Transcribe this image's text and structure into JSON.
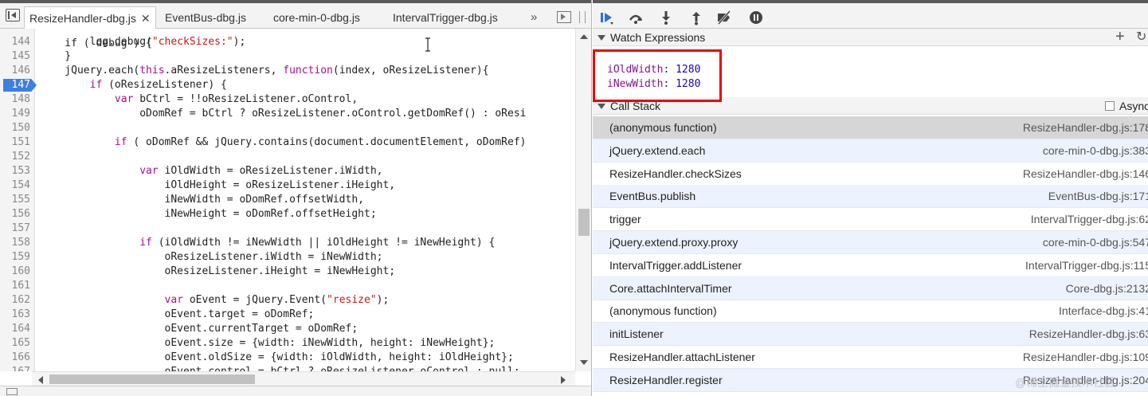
{
  "tabs": [
    {
      "label": "ResizeHandler-dbg.js",
      "active": true
    },
    {
      "label": "EventBus-dbg.js",
      "active": false
    },
    {
      "label": "core-min-0-dbg.js",
      "active": false
    },
    {
      "label": "IntervalTrigger-dbg.js",
      "active": false
    }
  ],
  "tab_overflow": "»",
  "code_lines": [
    {
      "n": "144",
      "html": "        log.debug(<span class='str'>\"checkSizes:\"</span>);"
    },
    {
      "n": "145",
      "html": "    }"
    },
    {
      "n": "146",
      "html": "    jQuery.each(<span class='kw'>this</span>.aResizeListeners, <span class='kw'>function</span>(index, oResizeListener){"
    },
    {
      "n": "147",
      "html": "        <span class='kw'>if</span> (oResizeListener) {",
      "breakpoint": true
    },
    {
      "n": "148",
      "html": "            <span class='kw'>var</span> bCtrl = !!oResizeListener.oControl,"
    },
    {
      "n": "149",
      "html": "                oDomRef = bCtrl ? oResizeListener.oControl.getDomRef() : oResi"
    },
    {
      "n": "150",
      "html": ""
    },
    {
      "n": "151",
      "html": "            <span class='kw'>if</span> ( oDomRef &amp;&amp; jQuery.contains(document.documentElement, oDomRef)"
    },
    {
      "n": "152",
      "html": ""
    },
    {
      "n": "153",
      "html": "                <span class='kw'>var</span> iOldWidth = oResizeListener.iWidth,"
    },
    {
      "n": "154",
      "html": "                    iOldHeight = oResizeListener.iHeight,"
    },
    {
      "n": "155",
      "html": "                    iNewWidth = oDomRef.offsetWidth,"
    },
    {
      "n": "156",
      "html": "                    iNewHeight = oDomRef.offsetHeight;"
    },
    {
      "n": "157",
      "html": ""
    },
    {
      "n": "158",
      "html": "                <span class='kw'>if</span> (iOldWidth != iNewWidth || iOldHeight != iNewHeight) {"
    },
    {
      "n": "159",
      "html": "                    oResizeListener.iWidth = iNewWidth;"
    },
    {
      "n": "160",
      "html": "                    oResizeListener.iHeight = iNewHeight;"
    },
    {
      "n": "161",
      "html": ""
    },
    {
      "n": "162",
      "html": "                    <span class='kw'>var</span> oEvent = jQuery.Event(<span class='str'>\"resize\"</span>);"
    },
    {
      "n": "163",
      "html": "                    oEvent.target = oDomRef;"
    },
    {
      "n": "164",
      "html": "                    oEvent.currentTarget = oDomRef;"
    },
    {
      "n": "165",
      "html": "                    oEvent.size = {width: iNewWidth, height: iNewHeight};"
    },
    {
      "n": "166",
      "html": "                    oEvent.oldSize = {width: iOldWidth, height: iOldHeight};"
    },
    {
      "n": "167",
      "html": "                    oEvent.control = bCtrl ? oResizeListener.oControl : null;"
    },
    {
      "n": "168",
      "html": ""
    }
  ],
  "top_partial_line": "    if ( debug ) {",
  "toolbar": {
    "resume": "resume-icon",
    "step_over": "step-over-icon",
    "step_into": "step-into-icon",
    "step_out": "step-out-icon",
    "deactivate": "deactivate-breakpoints-icon",
    "pause": "pause-on-exceptions-icon"
  },
  "watch": {
    "title": "Watch Expressions",
    "add": "+",
    "refresh": "↻",
    "items": [
      {
        "name": "iOldWidth",
        "sep": ": ",
        "value": "1280"
      },
      {
        "name": "iNewWidth",
        "sep": ": ",
        "value": "1280"
      }
    ]
  },
  "callstack": {
    "title": "Call Stack",
    "async_label": "Async",
    "frames": [
      {
        "fn": "(anonymous function)",
        "loc": "ResizeHandler-dbg.js:178",
        "selected": true
      },
      {
        "fn": "jQuery.extend.each",
        "loc": "core-min-0-dbg.js:383"
      },
      {
        "fn": "ResizeHandler.checkSizes",
        "loc": "ResizeHandler-dbg.js:146"
      },
      {
        "fn": "EventBus.publish",
        "loc": "EventBus-dbg.js:171"
      },
      {
        "fn": "trigger",
        "loc": "IntervalTrigger-dbg.js:62"
      },
      {
        "fn": "jQuery.extend.proxy.proxy",
        "loc": "core-min-0-dbg.js:547"
      },
      {
        "fn": "IntervalTrigger.addListener",
        "loc": "IntervalTrigger-dbg.js:115"
      },
      {
        "fn": "Core.attachIntervalTimer",
        "loc": "Core-dbg.js:2132"
      },
      {
        "fn": "(anonymous function)",
        "loc": "Interface-dbg.js:41"
      },
      {
        "fn": "initListener",
        "loc": "ResizeHandler-dbg.js:63"
      },
      {
        "fn": "ResizeHandler.attachListener",
        "loc": "ResizeHandler-dbg.js:109"
      },
      {
        "fn": "ResizeHandler.register",
        "loc": "ResizeHandler-dbg.js:204"
      }
    ]
  },
  "watermark": "@稀土掘金技术社区",
  "colors": {
    "breakpoint": "#3d7fe0",
    "highlight": "#ee0000",
    "keyword": "#aa0d91",
    "string": "#c41a16",
    "watch_name": "#881391",
    "watch_value": "#1c00cf"
  }
}
